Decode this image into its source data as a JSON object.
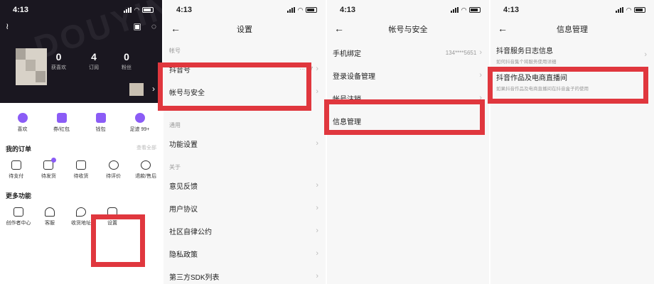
{
  "panel1": {
    "time": "4:13",
    "stats": [
      {
        "num": "0",
        "label": "获喜欢"
      },
      {
        "num": "4",
        "label": "订阅"
      },
      {
        "num": "0",
        "label": "粉丝"
      }
    ],
    "quick": [
      "喜欢",
      "券/红包",
      "钱包",
      "足迹 99+"
    ],
    "orders_title": "我的订单",
    "orders_more": "查看全部",
    "orders": [
      "待支付",
      "待发货",
      "待收货",
      "待评价",
      "退款/售后"
    ],
    "more_title": "更多功能",
    "more": [
      "创作者中心",
      "客服",
      "收货地址",
      "设置"
    ],
    "accent": "#8b5cf6"
  },
  "panel2": {
    "time": "4:13",
    "title": "设置",
    "group_account": "帐号",
    "row_id": "抖音号",
    "row_id_value": "··· 07",
    "row_account": "帐号与安全",
    "group_general": "通用",
    "row_function": "功能设置",
    "group_about": "关于",
    "rows_about": [
      "意见反馈",
      "用户协议",
      "社区自律公约",
      "隐私政策",
      "第三方SDK列表"
    ]
  },
  "panel3": {
    "time": "4:13",
    "title": "帐号与安全",
    "row_phone": "手机绑定",
    "row_phone_value": "134****5651",
    "row_devices": "登录设备管理",
    "row_cancel": "帐号注销",
    "row_info": "信息管理"
  },
  "panel4": {
    "time": "4:13",
    "title": "信息管理",
    "row_log": "抖音服务日志信息",
    "row_log_sub": "如何抖音集个将服务使用详细",
    "row_works": "抖音作品及电商直播间",
    "row_works_sub": "如果抖音作品及电商直播间在抖音盒子的使用"
  },
  "highlight_color": "#e0373e"
}
